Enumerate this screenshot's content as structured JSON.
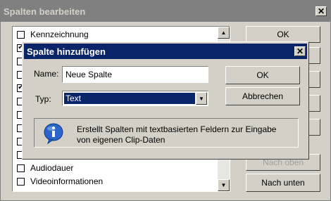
{
  "outer": {
    "title": "Spalten bearbeiten",
    "close_glyph": "✕",
    "list_items": [
      {
        "label": "Kennzeichnung",
        "checked": false
      },
      {
        "label": "",
        "checked": true
      },
      {
        "label": "",
        "checked": false
      },
      {
        "label": "",
        "checked": false
      },
      {
        "label": "",
        "checked": true
      },
      {
        "label": "",
        "checked": false
      },
      {
        "label": "",
        "checked": false
      },
      {
        "label": "",
        "checked": false
      },
      {
        "label": "",
        "checked": false
      },
      {
        "label": "",
        "checked": false
      },
      {
        "label": "Audiodauer",
        "checked": false
      },
      {
        "label": "Videoinformationen",
        "checked": false
      }
    ],
    "ok_label": "OK",
    "move_up_label": "Nach oben",
    "move_down_label": "Nach unten"
  },
  "dialog": {
    "title": "Spalte hinzufügen",
    "close_glyph": "✕",
    "name_label": "Name:",
    "name_value": "Neue Spalte",
    "type_label": "Typ:",
    "type_value": "Text",
    "ok_label": "OK",
    "cancel_label": "Abbrechen",
    "info_text_line1": "Erstellt Spalten mit textbasierten Feldern zur Eingabe",
    "info_text_line2": "von eigenen Clip-Daten"
  },
  "colors": {
    "titlebar_active": "#0a246a",
    "titlebar_inactive": "#808080",
    "face": "#d4d0c8"
  }
}
